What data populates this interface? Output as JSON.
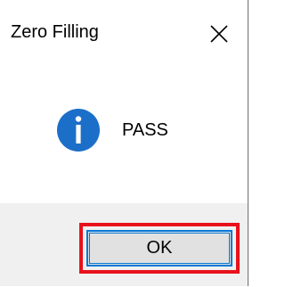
{
  "dialog": {
    "title": "Zero Filling",
    "message": "PASS",
    "ok_label": "OK",
    "icon": "info-icon"
  },
  "colors": {
    "info_icon": "#1c6fc9",
    "highlight": "#e8111b",
    "button_focus": "#0078d7"
  }
}
